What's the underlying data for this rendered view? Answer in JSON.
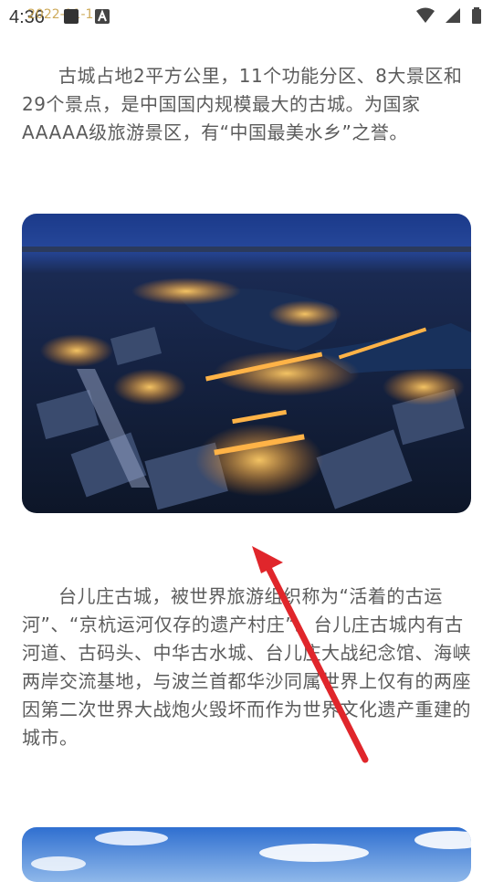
{
  "status_bar": {
    "time": "4:36",
    "overlay_text": "2022-11-1",
    "icons": [
      "notification-icon",
      "a-badge-icon",
      "wifi-icon",
      "signal-icon",
      "battery-icon"
    ]
  },
  "article": {
    "paragraph1": "古城占地2平方公里，11个功能分区、8大景区和29个景点，是中国国内规模最大的古城。为国家AAAAA级旅游景区，有“中国最美水乡”之誉。",
    "image1": "night-aerial-ancient-town-photo",
    "paragraph2": "台儿庄古城，被世界旅游组织称为“活着的古运河”、“京杭运河仅存的遗产村庄”。台儿庄古城内有古河道、古码头、中华古水城、台儿庄大战纪念馆、海峡两岸交流基地，与波兰首都华沙同属世界上仅有的两座因第二次世界大战炮火毁坏而作为世界文化遗产重建的城市。",
    "image2": "blue-sky-landscape-photo"
  },
  "annotation": {
    "arrow": "red-arrow-icon",
    "color": "#e0262b"
  }
}
